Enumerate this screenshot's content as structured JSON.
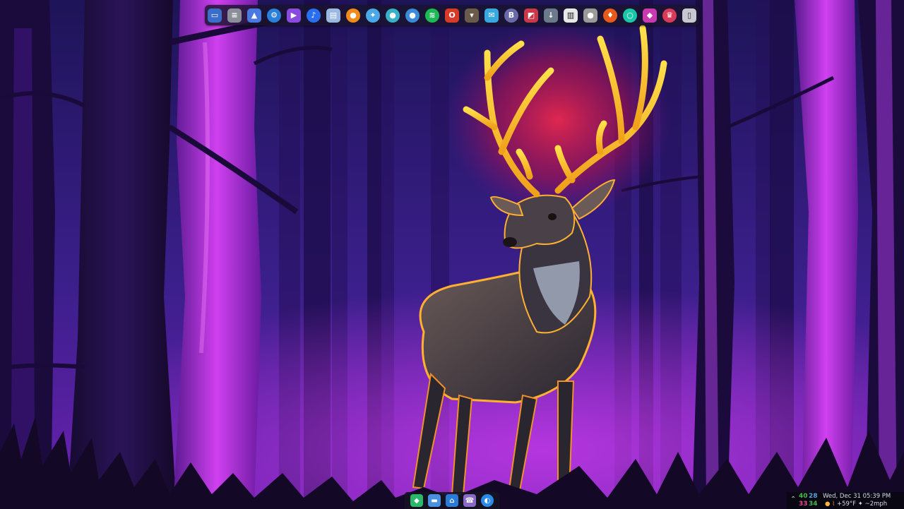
{
  "desktop": {
    "wallpaper": "purple-forest-glowing-stag"
  },
  "dock": {
    "apps": [
      {
        "icon": "desktop-icon",
        "color": "#3a6ec8"
      },
      {
        "icon": "document-icon",
        "color": "#8a8f9a"
      },
      {
        "icon": "mountain-chart-icon",
        "color": "#4a7ae0"
      },
      {
        "icon": "browser-settings-icon",
        "color": "#2a7fd8"
      },
      {
        "icon": "play-icon",
        "color": "#8a4ae0"
      },
      {
        "icon": "music-note-icon",
        "color": "#2a6ef0"
      },
      {
        "icon": "archive-icon",
        "color": "#9ab8e0"
      },
      {
        "icon": "blender-icon",
        "color": "#f08a1a"
      },
      {
        "icon": "bird-icon",
        "color": "#4aa8e8"
      },
      {
        "icon": "pin-icon",
        "color": "#3ab0c8"
      },
      {
        "icon": "user-icon",
        "color": "#3a8ad8"
      },
      {
        "icon": "spotify-icon",
        "color": "#1db954"
      },
      {
        "icon": "office-icon",
        "color": "#d83a2a"
      },
      {
        "icon": "cat-icon",
        "color": "#6a5a4a"
      },
      {
        "icon": "mail-icon",
        "color": "#3aa8e0"
      },
      {
        "icon": "b-badge-icon",
        "color": "#6a6aa8"
      },
      {
        "icon": "amd-icon",
        "color": "#c83a4a"
      },
      {
        "icon": "download-icon",
        "color": "#6a7a8a"
      },
      {
        "icon": "piano-icon",
        "color": "#e8e8e8"
      },
      {
        "icon": "person-icon",
        "color": "#9a9a9a"
      },
      {
        "icon": "fire-icon",
        "color": "#e85a1a"
      },
      {
        "icon": "ring-icon",
        "color": "#1ac8a8"
      },
      {
        "icon": "shield-icon",
        "color": "#c83ab0"
      },
      {
        "icon": "crown-icon",
        "color": "#d83a5a"
      },
      {
        "icon": "trash-icon",
        "color": "#c8c8d0"
      }
    ]
  },
  "taskbar": {
    "apps": [
      {
        "icon": "diamond-app-icon",
        "color": "#2ab86a"
      },
      {
        "icon": "folder-icon",
        "color": "#4a90e0"
      },
      {
        "icon": "inbox-icon",
        "color": "#2a7ad8"
      },
      {
        "icon": "phone-icon",
        "color": "#8a6ac8"
      },
      {
        "icon": "globe-icon",
        "color": "#2a8ae8"
      }
    ]
  },
  "tray": {
    "net_a": "40",
    "net_b": "28",
    "net_c": "33",
    "net_d": "34",
    "clock": "Wed, Dec 31  05:39 PM",
    "weather_temp": "+59°F",
    "weather_wind": "~2mph"
  }
}
